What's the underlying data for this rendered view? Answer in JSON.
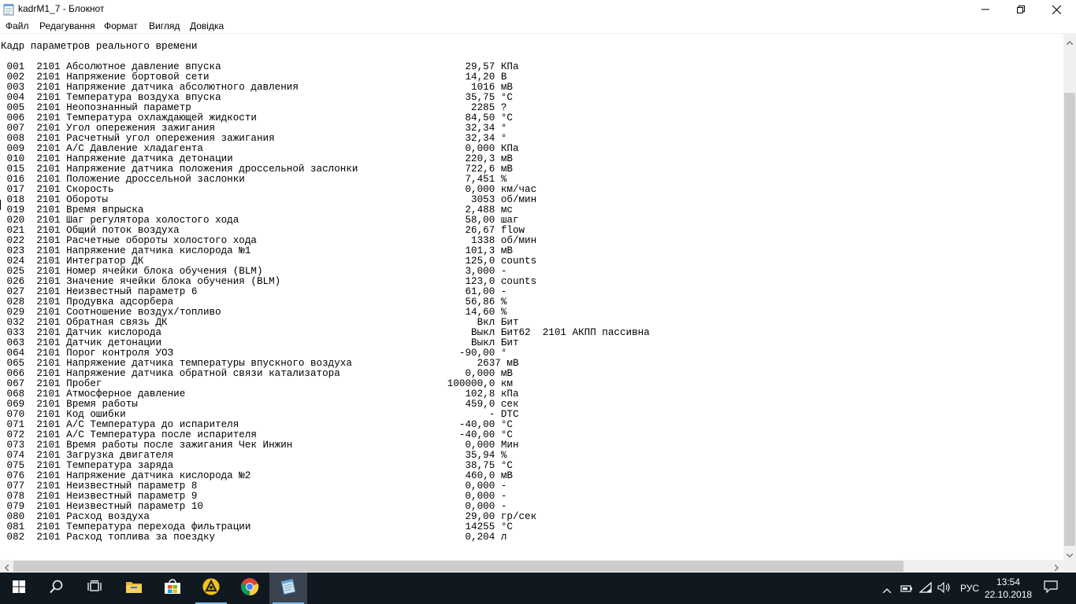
{
  "window": {
    "title": "kadrM1_7 - Блокнот",
    "icon": "notepad-icon",
    "controls": [
      "minimize-icon",
      "maximize-icon",
      "close-icon"
    ]
  },
  "menu": {
    "items": [
      "Файл",
      "Редагування",
      "Формат",
      "Вигляд",
      "Довідка"
    ]
  },
  "document": {
    "text": "Кадр параметров реального времени\n\n 001  2101 Абсолютное давление впуска                                         29,57 КПа\n 002  2101 Напряжение бортовой сети                                           14,20 В\n 003  2101 Напряжение датчика абсолютного давления                             1016 мВ\n 004  2101 Температура воздуха впуска                                         35,75 °C\n 005  2101 Неопознанный параметр                                               2285 ?\n 006  2101 Температура охлаждающей жидкости                                   84,50 °C\n 007  2101 Угол опережения зажигания                                          32,34 °\n 008  2101 Расчетный угол опережения зажигания                                32,34 °\n 009  2101 A/C Давление хладагента                                            0,000 КПа\n 010  2101 Напряжение датчика детонации                                       220,3 мВ\n 015  2101 Напряжение датчика положения дроссельной заслонки                  722,6 мВ\n 016  2101 Положение дроссельной заслонки                                     7,451 %\n 017  2101 Скорость                                                           0,000 км/час\n 018  2101 Обороты                                                             3053 об/мин\n 019  2101 Время впрыска                                                      2,488 мс\n 020  2101 Шаг регулятора холостого хода                                      58,00 шаг\n 021  2101 Общий поток воздуха                                                26,67 flow\n 022  2101 Расчетные обороты холостого хода                                    1338 об/мин\n 023  2101 Напряжение датчика кислорода №1                                    101,3 мВ\n 024  2101 Интегратор ДК                                                      125,0 counts\n 025  2101 Номер ячейки блока обучения (BLM)                                  3,000 -\n 026  2101 Значение ячейки блока обучения (BLM)                               123,0 counts\n 027  2101 Неизвестный параметр 6                                             61,00 -\n 028  2101 Продувка адсорбера                                                 56,86 %\n 029  2101 Соотношение воздух/топливо                                         14,60 %\n 032  2101 Обратная связь ДК                                                    Вкл Бит\n 033  2101 Датчик кислорода                                                    Выкл Бит62  2101 АКПП пассивна\n 063  2101 Датчик детонации                                                    Выкл Бит\n 064  2101 Порог контроля УОЗ                                                -90,00 °\n 065  2101 Напряжение датчика температуры впускного воздуха                     2637 мВ\n 066  2101 Напряжение датчика обратной связи катализатора                     0,000 мВ\n 067  2101 Пробег                                                          100000,0 км\n 068  2101 Атмосферное давление                                               102,8 кПа\n 069  2101 Время работы                                                       459,0 сек\n 070  2101 Код ошибки                                                             - DTC\n 071  2101 A/C Температура до испарителя                                     -40,00 °C\n 072  2101 A/C Температура после испарителя                                  -40,00 °C\n 073  2101 Время работы после зажигания Чек Инжин                             0,000 Мин\n 074  2101 Загрузка двигателя                                                 35,94 %\n 075  2101 Температура заряда                                                 38,75 °C\n 076  2101 Напряжение датчика кислорода №2                                    460,0 мВ\n 077  2101 Неизвестный параметр 8                                             0,000 -\n 078  2101 Неизвестный параметр 9                                             0,000 -\n 079  2101 Неизвестный параметр 10                                            0,000 -\n 080  2101 Расход воздуха                                                     29,00 гр/сек\n 081  2101 Температура перехода фильтрации                                    14255 °C\n 082  2101 Расход топлива за поездку                                          0,204 л"
  },
  "taskbar": {
    "apps": [
      "windows-start-icon",
      "search-icon",
      "task-view-icon",
      "file-explorer-icon",
      "store-icon",
      "app-icon",
      "chrome-icon",
      "notepad-icon"
    ],
    "tray": {
      "language": "РУС",
      "time": "13:54",
      "date": "22.10.2018"
    }
  },
  "colors": {
    "taskbar_bg": "#101820",
    "scrollbar_thumb": "#cdcdcd",
    "scrollbar_track": "#f0f0f0",
    "active_underline": "#76b9ed"
  }
}
